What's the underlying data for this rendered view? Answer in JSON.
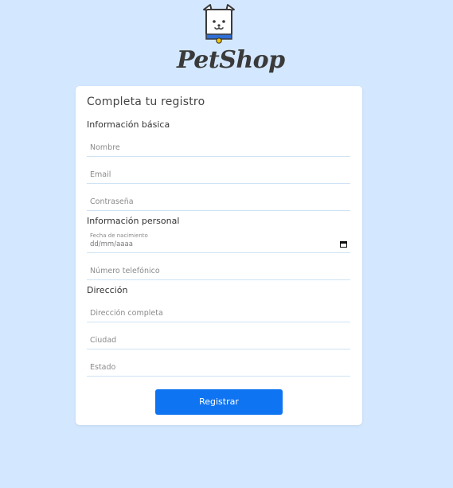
{
  "brand": {
    "name": "PetShop",
    "logo_icon": "dog-box-icon"
  },
  "form": {
    "title": "Completa tu registro",
    "sections": {
      "basic": "Información básica",
      "personal": "Información personal",
      "address": "Dirección"
    },
    "fields": {
      "nombre": "Nombre",
      "email": "Email",
      "password": "Contraseña",
      "birthdate_label": "Fecha de nacimiento",
      "birthdate_value": "dd/mm/aaaa",
      "phone": "Número telefónico",
      "address_full": "Dirección completa",
      "city": "Ciudad",
      "state": "Estado"
    },
    "submit_label": "Registrar"
  },
  "colors": {
    "background": "#d3e7fe",
    "card": "#ffffff",
    "accent": "#0f74f2",
    "collar": "#2f6fd6",
    "tag": "#f5c400"
  }
}
